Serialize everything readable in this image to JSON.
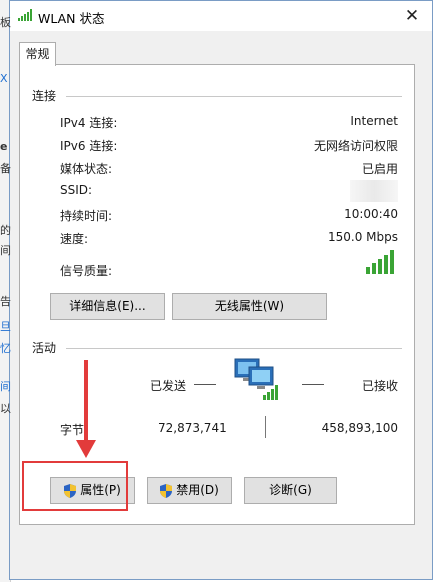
{
  "background_window": {
    "fragments": [
      "板",
      "X",
      "e",
      "备",
      "的",
      "间",
      "告",
      "旦",
      "忆",
      "间",
      "以"
    ]
  },
  "title": "WLAN 状态",
  "tab_label": "常规",
  "connection": {
    "group_label": "连接",
    "rows": [
      {
        "label": "IPv4 连接:",
        "value": "Internet"
      },
      {
        "label": "IPv6 连接:",
        "value": "无网络访问权限"
      },
      {
        "label": "媒体状态:",
        "value": "已启用"
      },
      {
        "label": "SSID:",
        "value": ""
      },
      {
        "label": "持续时间:",
        "value": "10:00:40"
      },
      {
        "label": "速度:",
        "value": "150.0 Mbps"
      },
      {
        "label": "信号质量:",
        "value": ""
      }
    ],
    "details_button": "详细信息(E)...",
    "wireless_button": "无线属性(W)"
  },
  "activity": {
    "group_label": "活动",
    "sent_label": "已发送",
    "received_label": "已接收",
    "bytes_label": "字节:",
    "bytes_sent": "72,873,741",
    "bytes_received": "458,893,100"
  },
  "buttons": {
    "properties": "属性(P)",
    "disable": "禁用(D)",
    "diagnose": "诊断(G)"
  },
  "colors": {
    "signal_green": "#3aa435",
    "highlight_red": "#e23b3b"
  }
}
